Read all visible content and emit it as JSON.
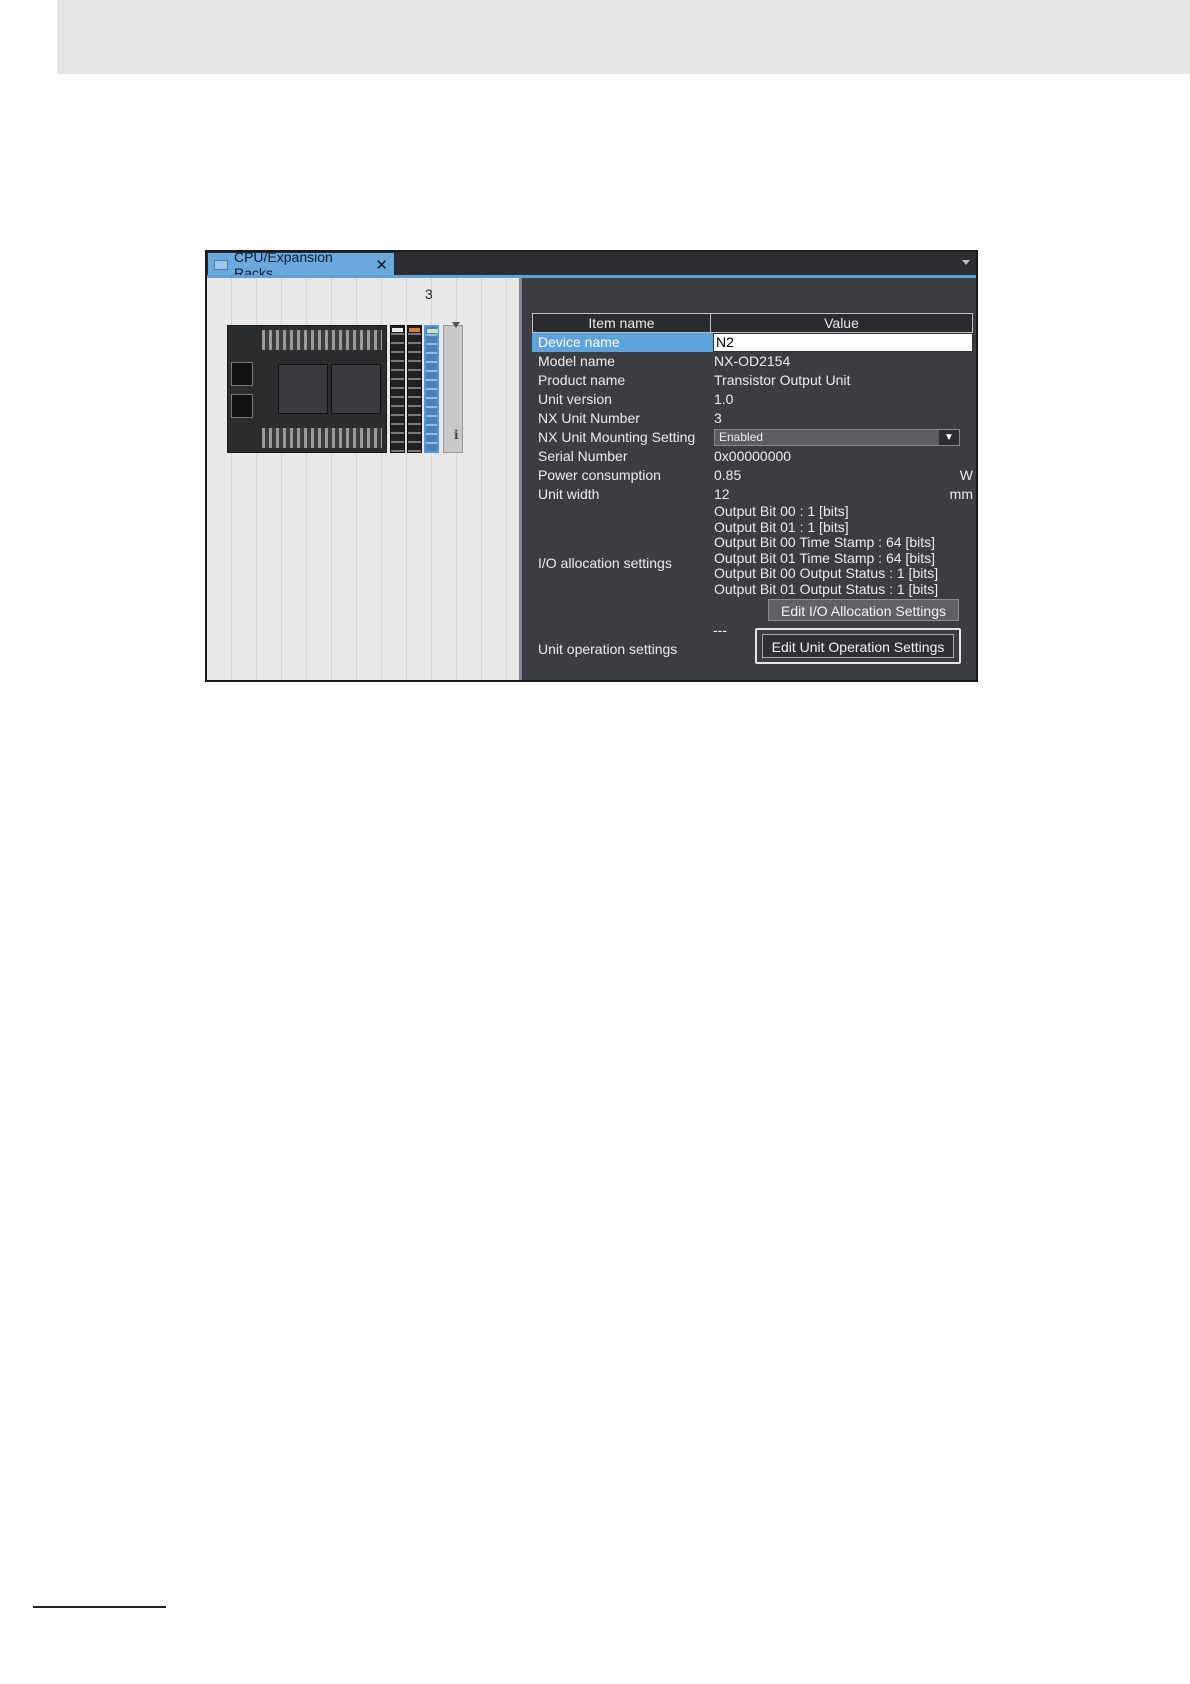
{
  "tab": {
    "title": "CPU/Expansion Racks",
    "close": "✕"
  },
  "rack": {
    "slot_number": "3",
    "info_icon": "i"
  },
  "table": {
    "headers": {
      "name": "Item name",
      "value": "Value"
    },
    "rows": [
      {
        "name": "Device name",
        "value": "N2",
        "selected": true
      },
      {
        "name": "Model name",
        "value": "NX-OD2154"
      },
      {
        "name": "Product name",
        "value": "Transistor Output Unit"
      },
      {
        "name": "Unit version",
        "value": "1.0"
      },
      {
        "name": "NX Unit Number",
        "value": "3"
      },
      {
        "name": "NX Unit Mounting Setting",
        "value": "Enabled",
        "type": "select"
      },
      {
        "name": "Serial Number",
        "value": "0x00000000"
      },
      {
        "name": "Power consumption",
        "value": "0.85",
        "unit": "W"
      },
      {
        "name": "Unit width",
        "value": "12",
        "unit": "mm"
      }
    ],
    "io_allocation": {
      "name": "I/O allocation settings",
      "lines": [
        "Output Bit 00 : 1 [bits]",
        "Output Bit 01 : 1 [bits]",
        "Output Bit 00 Time Stamp : 64 [bits]",
        "Output Bit 01 Time Stamp : 64 [bits]",
        "Output Bit 00 Output Status : 1 [bits]",
        "Output Bit 01 Output Status : 1 [bits]"
      ],
      "button": "Edit I/O Allocation Settings"
    },
    "unit_operation": {
      "name": "Unit operation settings",
      "value": "---",
      "button": "Edit Unit Operation Settings"
    }
  },
  "icons": {
    "tab": "rack-tab-icon",
    "close": "close-icon",
    "window_menu": "chevron-down-icon",
    "info": "info-icon",
    "dropdown": "dropdown-arrow-icon"
  },
  "colors": {
    "selection": "#5ea2db",
    "panel": "#3b3d42",
    "tab": "#6aa8de",
    "selected_unit": "#4b9be0"
  }
}
